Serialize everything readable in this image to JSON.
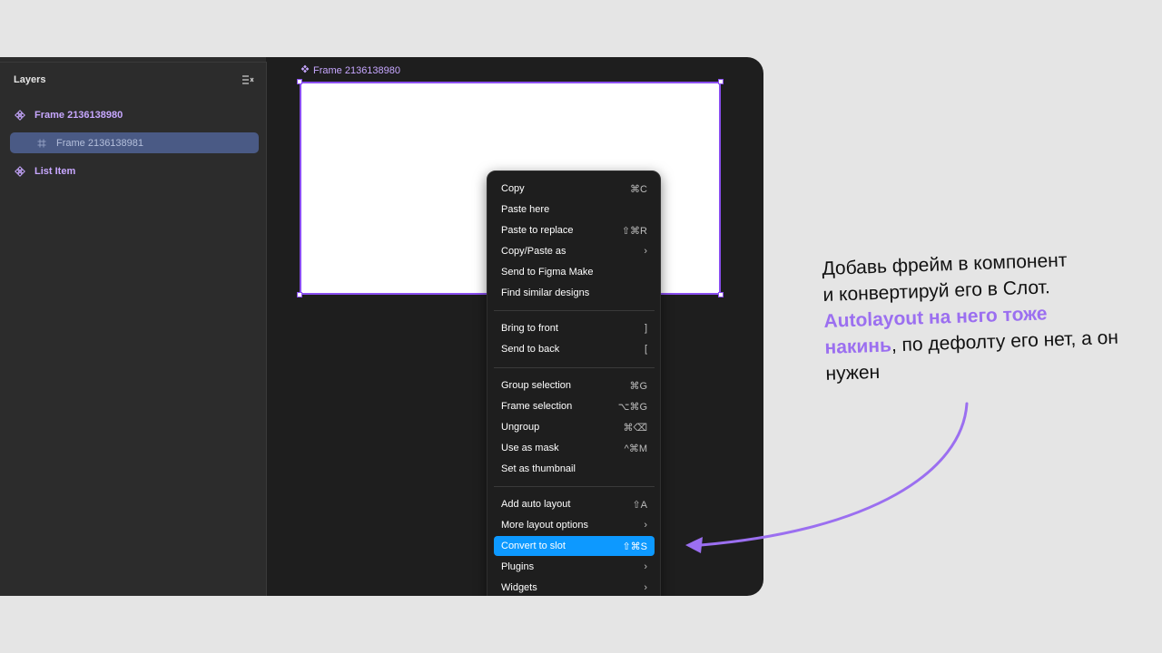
{
  "layers_panel": {
    "title": "Layers",
    "items": [
      {
        "label": "Frame 2136138980",
        "icon": "component-icon"
      },
      {
        "label": "Frame 2136138981",
        "icon": "frame-icon"
      },
      {
        "label": "List Item",
        "icon": "component-icon"
      }
    ]
  },
  "canvas": {
    "frame_label": "Frame 2136138980"
  },
  "context_menu": {
    "items": [
      {
        "label": "Copy",
        "shortcut": "⌘C"
      },
      {
        "label": "Paste here",
        "shortcut": ""
      },
      {
        "label": "Paste to replace",
        "shortcut": "⇧⌘R"
      },
      {
        "label": "Copy/Paste as",
        "shortcut": "›"
      },
      {
        "label": "Send to Figma Make",
        "shortcut": ""
      },
      {
        "label": "Find similar designs",
        "shortcut": ""
      },
      {
        "label": "Bring to front",
        "shortcut": "]"
      },
      {
        "label": "Send to back",
        "shortcut": "["
      },
      {
        "label": "Group selection",
        "shortcut": "⌘G"
      },
      {
        "label": "Frame selection",
        "shortcut": "⌥⌘G"
      },
      {
        "label": "Ungroup",
        "shortcut": "⌘⌫"
      },
      {
        "label": "Use as mask",
        "shortcut": "^⌘M"
      },
      {
        "label": "Set as thumbnail",
        "shortcut": ""
      },
      {
        "label": "Add auto layout",
        "shortcut": "⇧A"
      },
      {
        "label": "More layout options",
        "shortcut": "›"
      },
      {
        "label": "Convert to slot",
        "shortcut": "⇧⌘S"
      },
      {
        "label": "Plugins",
        "shortcut": "›"
      },
      {
        "label": "Widgets",
        "shortcut": "›"
      }
    ]
  },
  "annotation": {
    "line1": "Добавь фрейм в компонент",
    "line2": "и конвертируй его в Слот.",
    "accent": "Autolayout на него тоже накинь",
    "rest": ", по дефолту его нет, а он нужен"
  },
  "colors": {
    "accent_purple": "#9b6ff0",
    "highlight_blue": "#0d99ff",
    "selection_border": "#8a4ef0"
  }
}
